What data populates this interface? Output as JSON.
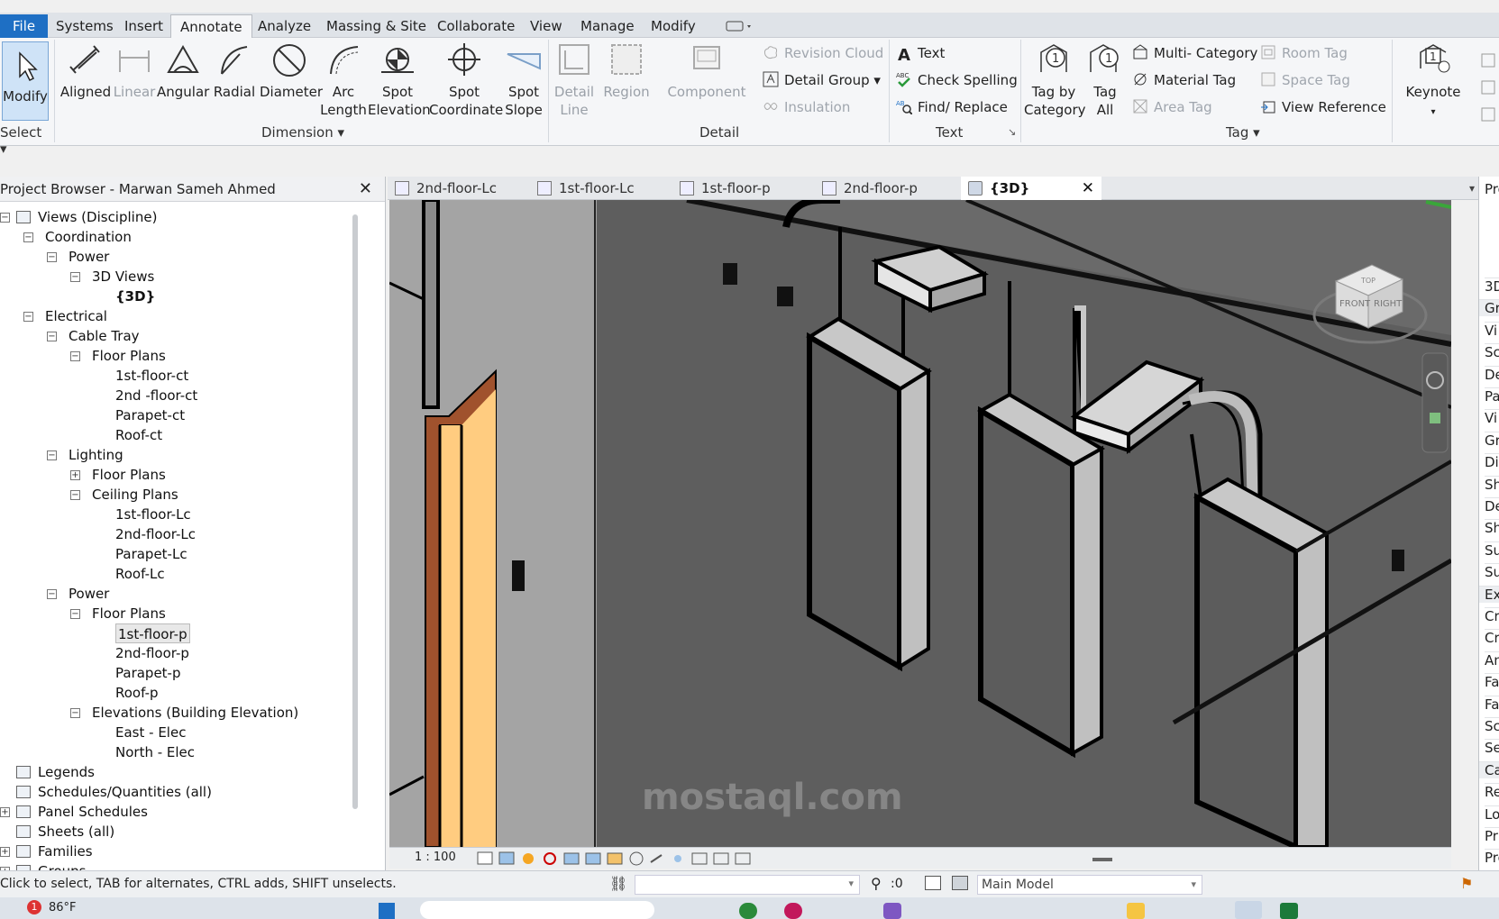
{
  "menu": {
    "tabs": [
      "File",
      "Systems",
      "Insert",
      "Annotate",
      "Analyze",
      "Massing & Site",
      "Collaborate",
      "View",
      "Manage",
      "Modify"
    ]
  },
  "ribbon": {
    "select_group": {
      "button": "Modify",
      "panel": "Select"
    },
    "dimension": {
      "buttons": [
        "Aligned",
        "Linear",
        "Angular",
        "Radial",
        "Diameter",
        "Arc Length",
        "Spot Elevation",
        "Spot Coordinate",
        "Spot Slope"
      ],
      "panel": "Dimension"
    },
    "detail": {
      "detail_line": "Detail Line",
      "region": "Region",
      "component": "Component",
      "revision_cloud": "Revision Cloud",
      "detail_group": "Detail Group",
      "insulation": "Insulation",
      "panel": "Detail"
    },
    "text": {
      "text": "Text",
      "check_spelling": "Check Spelling",
      "find_replace": "Find/ Replace",
      "panel": "Text"
    },
    "tag": {
      "tag_by_category": "Tag by Category",
      "tag_all": "Tag All",
      "multi_category": "Multi- Category",
      "material_tag": "Material Tag",
      "area_tag": "Area Tag",
      "room_tag": "Room Tag",
      "space_tag": "Space Tag",
      "view_reference": "View Reference",
      "panel": "Tag"
    },
    "keynote": "Keynote"
  },
  "project_browser": {
    "title": "Project Browser - Marwan Sameh Ahmed",
    "items": [
      "Views (Discipline)",
      "Coordination",
      "Power",
      "3D Views",
      "{3D}",
      "Electrical",
      "Cable Tray",
      "Floor Plans",
      "1st-floor-ct",
      "2nd -floor-ct",
      "Parapet-ct",
      "Roof-ct",
      "Lighting",
      "Floor Plans",
      "Ceiling Plans",
      "1st-floor-Lc",
      "2nd-floor-Lc",
      "Parapet-Lc",
      "Roof-Lc",
      "Power",
      "Floor Plans",
      "1st-floor-p",
      "2nd-floor-p",
      "Parapet-p",
      "Roof-p",
      "Elevations (Building Elevation)",
      "East - Elec",
      "North - Elec",
      "Legends",
      "Schedules/Quantities (all)",
      "Panel Schedules",
      "Sheets (all)",
      "Families",
      "Groups"
    ]
  },
  "view_tabs": [
    "2nd-floor-Lc",
    "1st-floor-Lc",
    "1st-floor-p",
    "2nd-floor-p",
    "{3D}"
  ],
  "viewcube": {
    "front": "FRONT",
    "right": "RIGHT",
    "top": "TOP"
  },
  "view_bar": {
    "scale": "1 : 100"
  },
  "status": {
    "message": "Click to select, TAB for alternates, CTRL adds, SHIFT unselects.",
    "selection_count": ":0",
    "model": "Main Model"
  },
  "taskbar": {
    "temperature": "86°F",
    "badge": "1"
  },
  "properties": {
    "title": "Pro",
    "rows": [
      "3D",
      "Gra",
      "Vi",
      "Sc",
      "De",
      "Pa",
      "Vi",
      "Gr",
      "Di",
      "Sh",
      "De",
      "Sh",
      "Su",
      "Su",
      "Ext",
      "Cr",
      "Cr",
      "An",
      "Fa",
      "Fa",
      "Sc",
      "Se",
      "Car",
      "Re",
      "Lo",
      "Pr",
      "Pro"
    ]
  },
  "watermark": {
    "text": "mostaql.com"
  }
}
